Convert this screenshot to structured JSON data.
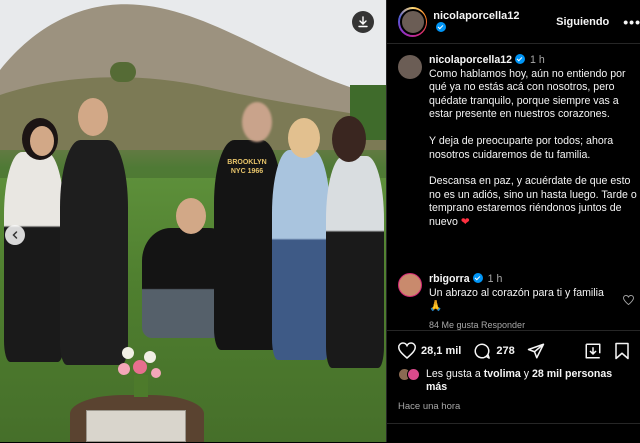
{
  "post": {
    "username": "nicolaporcella12",
    "follow_label": "Siguiendo",
    "more_label": "•••",
    "caption_time": "1 h",
    "caption_paragraphs": [
      "Como hablamos hoy, aún no entiendo por qué ya no estás acá con nosotros, pero quédate tranquilo, porque siempre vas a estar presente en nuestros corazones.",
      "Y deja de preocuparte por todos; ahora nosotros cuidaremos de tu familia.",
      "Descansa en paz, y acuérdate de que esto no es un adiós, sino un hasta luego. Tarde o temprano estaremos riéndonos juntos de nuevo"
    ],
    "caption_emoji": "❤"
  },
  "comment": {
    "username": "rbigorra",
    "time": "1 h",
    "text": "Un abrazo al corazón para ti y familia 🙏",
    "meta": "84 Me gusta   Responder"
  },
  "actions": {
    "likes_count": "28,1 mil",
    "comments_count": "278"
  },
  "liked_by": {
    "prefix": "Les gusta a",
    "user": "tvolima",
    "joiner": "y",
    "others": "28 mil personas más"
  },
  "timestamp": "Hace una hora",
  "photo": {
    "shirt_text": "BROOKLYN NYC 1966"
  },
  "colors": {
    "background": "#000000",
    "verified": "#0095f6",
    "heart": "#ff3040",
    "muted": "#a8a8a8"
  },
  "icons": [
    "download-icon",
    "chevron-left-icon",
    "verified-icon",
    "heart-icon",
    "comment-icon",
    "share-icon",
    "repost-icon",
    "bookmark-icon"
  ]
}
